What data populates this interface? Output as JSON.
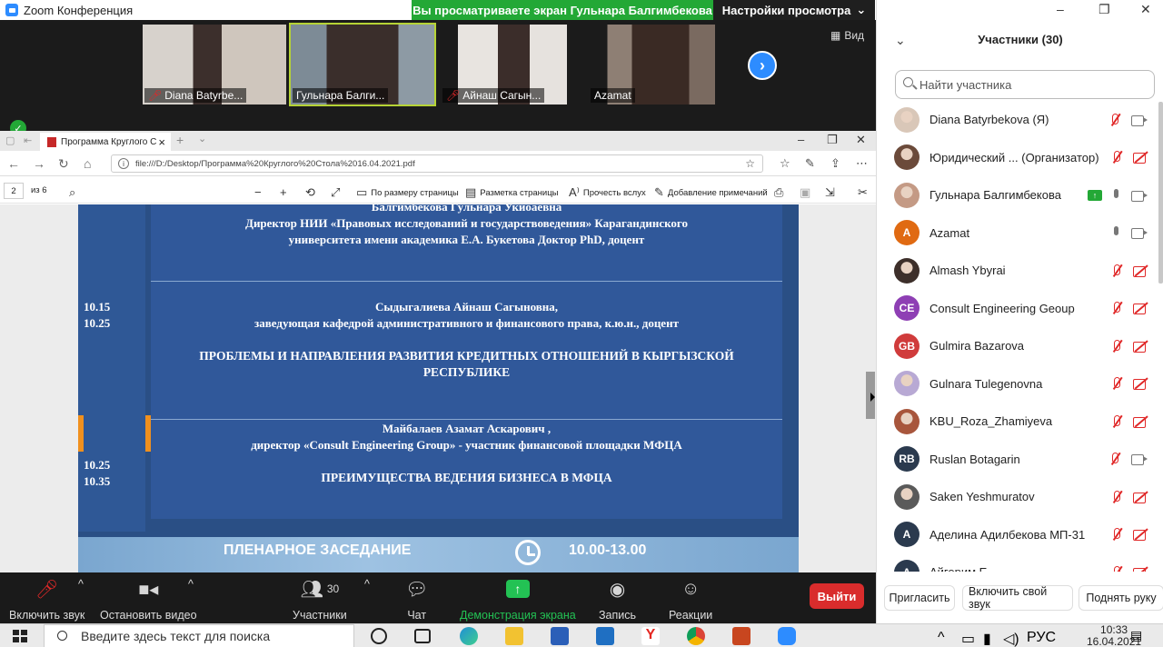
{
  "window": {
    "title": "Zoom Конференция",
    "share_banner": "Вы просматриваете экран Гульнара Балгимбекова",
    "view_options": "Настройки просмотра",
    "view_button": "Вид"
  },
  "video_tiles": [
    {
      "name": "Diana Batyrbe...",
      "muted": true
    },
    {
      "name": "Гульнара Балги...",
      "muted": false,
      "active": true
    },
    {
      "name": "Айнаш Сагын...",
      "muted": true
    },
    {
      "name": "Azamat",
      "muted": false
    }
  ],
  "browser": {
    "tab_title": "Программа Круглого С",
    "url": "file:///D:/Desktop/Программа%20Круглого%20Стола%2016.04.2021.pdf",
    "page_number": "2",
    "page_of": "из 6",
    "tools": {
      "fit_page": "По размеру страницы",
      "page_layout": "Разметка страницы",
      "read_aloud": "Прочесть вслух",
      "add_notes": "Добавление примечаний"
    }
  },
  "pdf": {
    "block1_line0": "Балгимбекова Гульнара Укиоаевна",
    "block1_line1": "Директор НИИ «Правовых исследований и государствоведения» Карагандинского",
    "block1_line2": "университета имени  академика Е.А. Букетова  Доктор PhD, доцент",
    "block2_time1": "10.15",
    "block2_time2": "10.25",
    "block2_name": "Сыдыгалиева Айнаш Сагыновна,",
    "block2_role": "заведующая кафедрой административного и финансового права, к.ю.н., доцент",
    "block2_topic1": "ПРОБЛЕМЫ И НАПРАВЛЕНИЯ РАЗВИТИЯ КРЕДИТНЫХ ОТНОШЕНИЙ В КЫРГЫЗСКОЙ",
    "block2_topic2": "РЕСПУБЛИКЕ",
    "block3_name": "Майбалаев Азамат Аскарович ,",
    "block3_role": "директор  «Consult Engineering Group» - участник финансовой площадки МФЦА",
    "block3_time1": "10.25",
    "block3_time2": "10.35",
    "block3_topic": "ПРЕИМУЩЕСТВА ВЕДЕНИЯ  БИЗНЕСА В МФЦА",
    "plenary_title": "ПЛЕНАРНОЕ ЗАСЕДАНИЕ",
    "plenary_time": "10.00-13.00"
  },
  "toolbar": {
    "mute": "Включить звук",
    "video": "Остановить видео",
    "participants_count": "30",
    "participants": "Участники",
    "chat": "Чат",
    "share": "Демонстрация экрана",
    "record": "Запись",
    "reactions": "Реакции",
    "leave": "Выйти"
  },
  "panel": {
    "title": "Участники (30)",
    "search_placeholder": "Найти участника",
    "participants": [
      {
        "name": "Diana Batyrbekova (Я)",
        "avatar": "photo",
        "color": "#d9c7b8",
        "mic": "off",
        "cam": "on"
      },
      {
        "name": "Юридический ...  (Организатор)",
        "avatar": "photo",
        "color": "#6b4a3a",
        "mic": "off",
        "cam": "off"
      },
      {
        "name": "Гульнара Балгимбекова",
        "avatar": "photo",
        "color": "#c49a85",
        "mic": "on",
        "cam": "on",
        "sharing": true
      },
      {
        "name": "Azamat",
        "avatar": "A",
        "color": "#e06a12",
        "mic": "on",
        "cam": "on"
      },
      {
        "name": "Almash Ybyrai",
        "avatar": "photo",
        "color": "#3d2f2a",
        "mic": "off",
        "cam": "off"
      },
      {
        "name": "Consult Engineering Geoup",
        "avatar": "CE",
        "color": "#8e3fb4",
        "mic": "off",
        "cam": "off"
      },
      {
        "name": "Gulmira Bazarova",
        "avatar": "GB",
        "color": "#d03b3b",
        "mic": "off",
        "cam": "off"
      },
      {
        "name": "Gulnara Tulegenovna",
        "avatar": "photo",
        "color": "#b8a9d4",
        "mic": "off",
        "cam": "off"
      },
      {
        "name": "KBU_Roza_Zhamiyeva",
        "avatar": "photo",
        "color": "#a8563c",
        "mic": "off",
        "cam": "off"
      },
      {
        "name": "Ruslan Botagarin",
        "avatar": "RB",
        "color": "#2b3a4e",
        "mic": "off",
        "cam": "on"
      },
      {
        "name": "Saken Yeshmuratov",
        "avatar": "photo",
        "color": "#5a5a5a",
        "mic": "off",
        "cam": "off"
      },
      {
        "name": "Аделина Адилбекова МП-31",
        "avatar": "A",
        "color": "#2b3a4e",
        "mic": "off",
        "cam": "off"
      },
      {
        "name": "Айгерим Е...",
        "avatar": "A",
        "color": "#2b3a4e",
        "mic": "off",
        "cam": "off"
      }
    ],
    "invite": "Пригласить",
    "unmute_me": "Включить свой звук",
    "raise_hand": "Поднять руку"
  },
  "taskbar": {
    "search_placeholder": "Введите здесь текст для поиска",
    "lang": "РУС",
    "time": "10:33",
    "date": "16.04.2021"
  }
}
